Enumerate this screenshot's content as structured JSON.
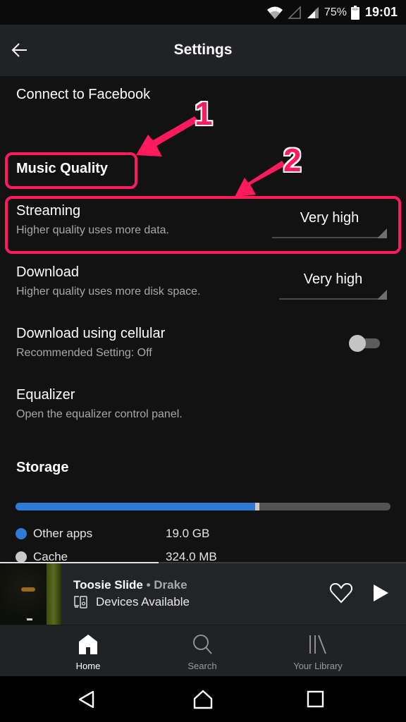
{
  "status_bar": {
    "icons": [
      "wifi-icon",
      "mobile-signal-empty-icon",
      "cell-signal-icon",
      "battery-icon"
    ],
    "battery": "75%",
    "time": "19:01"
  },
  "header": {
    "back_icon": "arrow-left-icon",
    "title": "Settings"
  },
  "settings": {
    "connect_facebook": "Connect to Facebook",
    "music_quality_heading": "Music Quality",
    "streaming": {
      "title": "Streaming",
      "subtitle": "Higher quality uses more data.",
      "value": "Very high"
    },
    "download": {
      "title": "Download",
      "subtitle": "Higher quality uses more disk space.",
      "value": "Very high"
    },
    "download_cellular": {
      "title": "Download using cellular",
      "subtitle": "Recommended Setting: Off",
      "enabled": false
    },
    "equalizer": {
      "title": "Equalizer",
      "subtitle": "Open the equalizer control panel."
    },
    "storage_heading": "Storage",
    "storage": {
      "bar_segments": [
        {
          "name": "Other apps",
          "fraction": 0.64,
          "color": "#2d7bd4"
        },
        {
          "name": "Cache",
          "fraction": 0.011,
          "color": "#c8c8c8"
        }
      ],
      "bar_background": "#535353",
      "legend": [
        {
          "label": "Other apps",
          "value": "19.0 GB",
          "color": "#2d7bd4"
        },
        {
          "label": "Cache",
          "value": "324.0 MB",
          "color": "#c8c8c8"
        }
      ]
    }
  },
  "annotations": {
    "color": "#ff1a5e",
    "labels": [
      "1",
      "2"
    ]
  },
  "now_playing": {
    "track": "Toosie Slide",
    "separator": " • ",
    "artist": "Drake",
    "devices_label": "Devices Available",
    "progress": 0.39,
    "icons": [
      "devices-icon",
      "heart-icon",
      "play-icon"
    ]
  },
  "bottom_nav": {
    "items": [
      {
        "label": "Home",
        "icon": "home-icon",
        "active": true
      },
      {
        "label": "Search",
        "icon": "search-icon",
        "active": false
      },
      {
        "label": "Your Library",
        "icon": "library-icon",
        "active": false
      }
    ]
  },
  "system_nav": {
    "icons": [
      "back-triangle-icon",
      "home-outline-icon",
      "recents-square-icon"
    ]
  }
}
